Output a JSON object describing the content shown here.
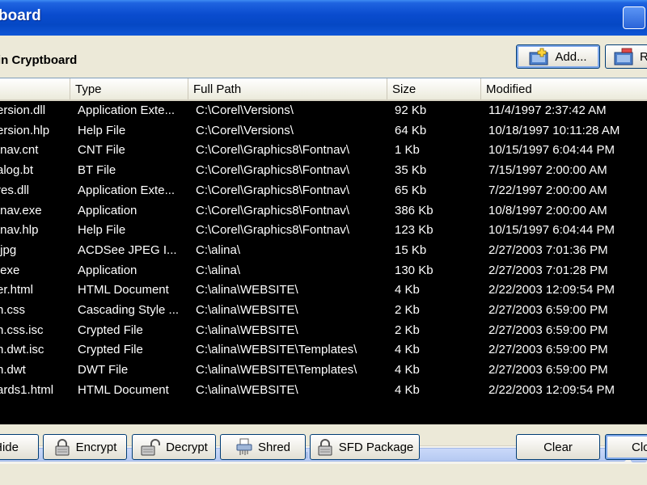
{
  "window": {
    "title": "board"
  },
  "header": {
    "label": "in Cryptboard"
  },
  "toolbar": {
    "add_label": "Add...",
    "remove_label": "Re"
  },
  "columns": [
    "",
    "Type",
    "Full Path",
    "Size",
    "Modified"
  ],
  "rows": [
    [
      "ersion.dll",
      "Application Exte...",
      "C:\\Corel\\Versions\\",
      "92 Kb",
      "11/4/1997 2:37:42 AM"
    ],
    [
      "ersion.hlp",
      "Help File",
      "C:\\Corel\\Versions\\",
      "64 Kb",
      "10/18/1997 10:11:28 AM"
    ],
    [
      "tnav.cnt",
      "CNT File",
      "C:\\Corel\\Graphics8\\Fontnav\\",
      "1 Kb",
      "10/15/1997 6:04:44 PM"
    ],
    [
      "alog.bt",
      "BT File",
      "C:\\Corel\\Graphics8\\Fontnav\\",
      "35 Kb",
      "7/15/1997 2:00:00 AM"
    ],
    [
      "res.dll",
      "Application Exte...",
      "C:\\Corel\\Graphics8\\Fontnav\\",
      "65 Kb",
      "7/22/1997 2:00:00 AM"
    ],
    [
      "tnav.exe",
      "Application",
      "C:\\Corel\\Graphics8\\Fontnav\\",
      "386 Kb",
      "10/8/1997 2:00:00 AM"
    ],
    [
      "tnav.hlp",
      "Help File",
      "C:\\Corel\\Graphics8\\Fontnav\\",
      "123 Kb",
      "10/15/1997 6:04:44 PM"
    ],
    [
      ".jpg",
      "ACDSee JPEG I...",
      "C:\\alina\\",
      "15 Kb",
      "2/27/2003 7:01:36 PM"
    ],
    [
      ".exe",
      "Application",
      "C:\\alina\\",
      "130 Kb",
      "2/27/2003 7:01:28 PM"
    ],
    [
      "er.html",
      "HTML Document",
      "C:\\alina\\WEBSITE\\",
      "4 Kb",
      "2/22/2003 12:09:54 PM"
    ],
    [
      "n.css",
      "Cascading Style ...",
      "C:\\alina\\WEBSITE\\",
      "2 Kb",
      "2/27/2003 6:59:00 PM"
    ],
    [
      "n.css.isc",
      "Crypted File",
      "C:\\alina\\WEBSITE\\",
      "2 Kb",
      "2/27/2003 6:59:00 PM"
    ],
    [
      "n.dwt.isc",
      "Crypted File",
      "C:\\alina\\WEBSITE\\Templates\\",
      "4 Kb",
      "2/27/2003 6:59:00 PM"
    ],
    [
      "n.dwt",
      "DWT File",
      "C:\\alina\\WEBSITE\\Templates\\",
      "4 Kb",
      "2/27/2003 6:59:00 PM"
    ],
    [
      "ards1.html",
      "HTML Document",
      "C:\\alina\\WEBSITE\\",
      "4 Kb",
      "2/22/2003 12:09:54 PM"
    ]
  ],
  "actions": {
    "hide_label": "Hide",
    "encrypt_label": "Encrypt",
    "decrypt_label": "Decrypt",
    "shred_label": "Shred",
    "sfd_label": "SFD Package",
    "clear_label": "Clear",
    "close_label": "Clo"
  },
  "colors": {
    "titlebar": "#0a4ccf",
    "list_bg": "#000000",
    "list_text": "#ffffff",
    "window_bg": "#ece9d8"
  }
}
